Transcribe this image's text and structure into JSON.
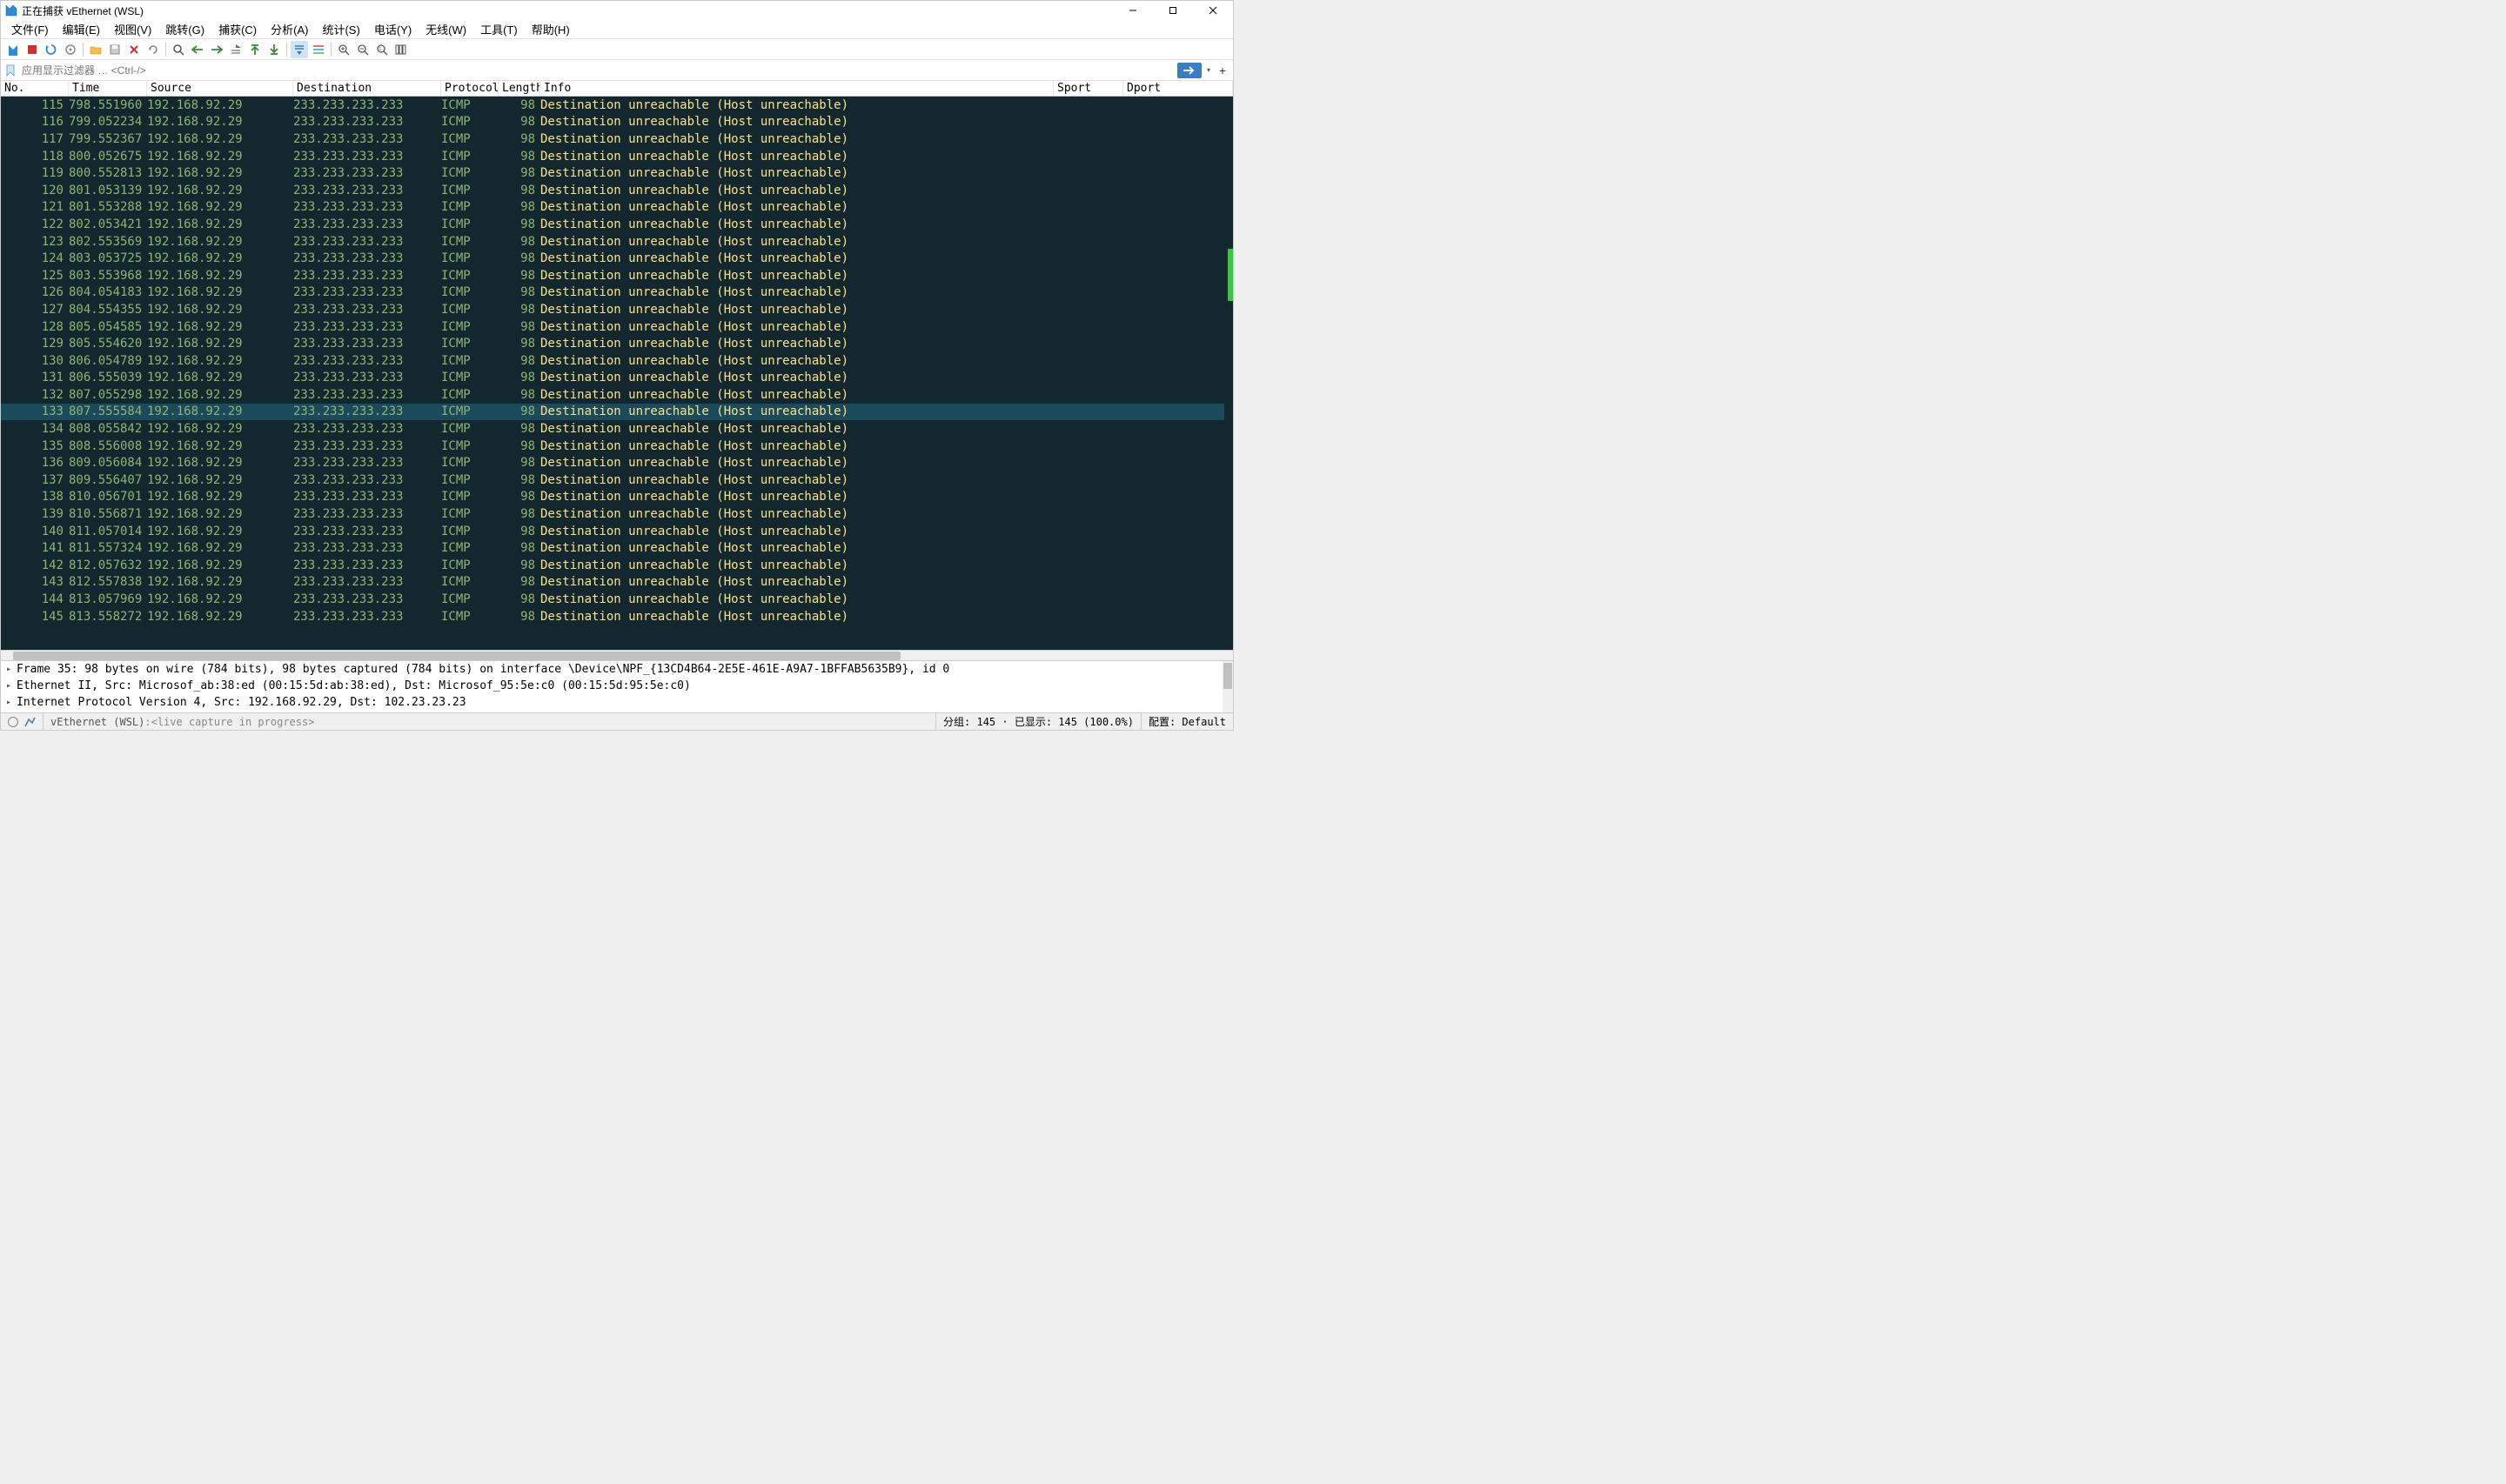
{
  "window": {
    "title": "正在捕获 vEthernet (WSL)"
  },
  "menu": {
    "file": "文件(F)",
    "edit": "编辑(E)",
    "view": "视图(V)",
    "goto": "跳转(G)",
    "capture": "捕获(C)",
    "analyze": "分析(A)",
    "stats": "统计(S)",
    "telephony": "电话(Y)",
    "wireless": "无线(W)",
    "tools": "工具(T)",
    "help": "帮助(H)"
  },
  "filter": {
    "placeholder": "应用显示过滤器 … <Ctrl-/>",
    "value": ""
  },
  "columns": {
    "no": "No.",
    "time": "Time",
    "source": "Source",
    "destination": "Destination",
    "protocol": "Protocol",
    "length": "Length",
    "info": "Info",
    "sport": "Sport",
    "dport": "Dport"
  },
  "packets_common": {
    "source": "192.168.92.29",
    "destination": "233.233.233.233",
    "protocol": "ICMP",
    "length": "98",
    "info": "Destination unreachable (Host unreachable)"
  },
  "packets": [
    {
      "no": "115",
      "time": "798.551960"
    },
    {
      "no": "116",
      "time": "799.052234"
    },
    {
      "no": "117",
      "time": "799.552367"
    },
    {
      "no": "118",
      "time": "800.052675"
    },
    {
      "no": "119",
      "time": "800.552813"
    },
    {
      "no": "120",
      "time": "801.053139"
    },
    {
      "no": "121",
      "time": "801.553288"
    },
    {
      "no": "122",
      "time": "802.053421"
    },
    {
      "no": "123",
      "time": "802.553569"
    },
    {
      "no": "124",
      "time": "803.053725"
    },
    {
      "no": "125",
      "time": "803.553968"
    },
    {
      "no": "126",
      "time": "804.054183"
    },
    {
      "no": "127",
      "time": "804.554355"
    },
    {
      "no": "128",
      "time": "805.054585"
    },
    {
      "no": "129",
      "time": "805.554620"
    },
    {
      "no": "130",
      "time": "806.054789"
    },
    {
      "no": "131",
      "time": "806.555039"
    },
    {
      "no": "132",
      "time": "807.055298"
    },
    {
      "no": "133",
      "time": "807.555584",
      "selected": true
    },
    {
      "no": "134",
      "time": "808.055842"
    },
    {
      "no": "135",
      "time": "808.556008"
    },
    {
      "no": "136",
      "time": "809.056084"
    },
    {
      "no": "137",
      "time": "809.556407"
    },
    {
      "no": "138",
      "time": "810.056701"
    },
    {
      "no": "139",
      "time": "810.556871"
    },
    {
      "no": "140",
      "time": "811.057014"
    },
    {
      "no": "141",
      "time": "811.557324"
    },
    {
      "no": "142",
      "time": "812.057632"
    },
    {
      "no": "143",
      "time": "812.557838"
    },
    {
      "no": "144",
      "time": "813.057969"
    },
    {
      "no": "145",
      "time": "813.558272"
    }
  ],
  "details": {
    "frame": "Frame 35: 98 bytes on wire (784 bits), 98 bytes captured (784 bits) on interface \\Device\\NPF_{13CD4B64-2E5E-461E-A9A7-1BFFAB5635B9}, id 0",
    "eth": "Ethernet II, Src: Microsof_ab:38:ed (00:15:5d:ab:38:ed), Dst: Microsof_95:5e:c0 (00:15:5d:95:5e:c0)",
    "ip": "Internet Protocol Version 4, Src: 192.168.92.29, Dst: 102.23.23.23"
  },
  "status": {
    "iface": "vEthernet (WSL)",
    "capture_hint": "<live capture in progress>",
    "stats": "分组: 145 · 已显示: 145 (100.0%)",
    "profile": "配置: Default"
  }
}
